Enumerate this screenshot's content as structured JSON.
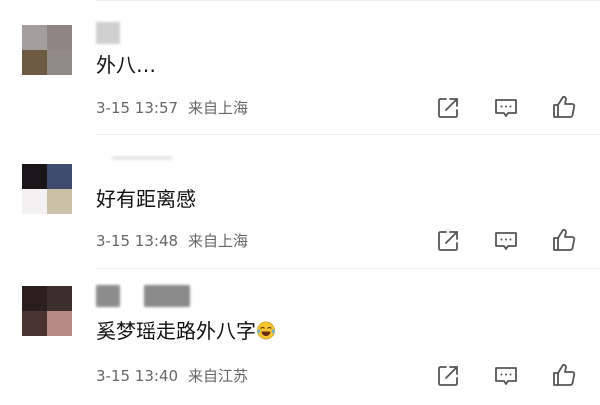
{
  "comments": [
    {
      "text": "外八…",
      "time": "3-15 13:57",
      "source": "来自上海",
      "avatar_colors": [
        "#a39d9c",
        "#8f8582",
        "#6d5a43",
        "#928a87"
      ]
    },
    {
      "text": "好有距离感",
      "time": "3-15 13:48",
      "source": "来自上海",
      "avatar_colors": [
        "#1a1519",
        "#3e4a6e",
        "#f3f1f2",
        "#c9c1a8"
      ]
    },
    {
      "text": "奚梦瑶走路外八字",
      "time": "3-15 13:40",
      "source": "来自江苏",
      "avatar_colors": [
        "#2b1f1d",
        "#3d2d2b",
        "#4a3431",
        "#b88c84"
      ]
    }
  ],
  "icons": {
    "share": "share-icon",
    "comment": "comment-icon",
    "like": "like-icon",
    "emoji": "laugh-cry-emoji-icon"
  },
  "colors": {
    "icon": "#555555",
    "meta": "#666666",
    "divider": "#ececec"
  }
}
